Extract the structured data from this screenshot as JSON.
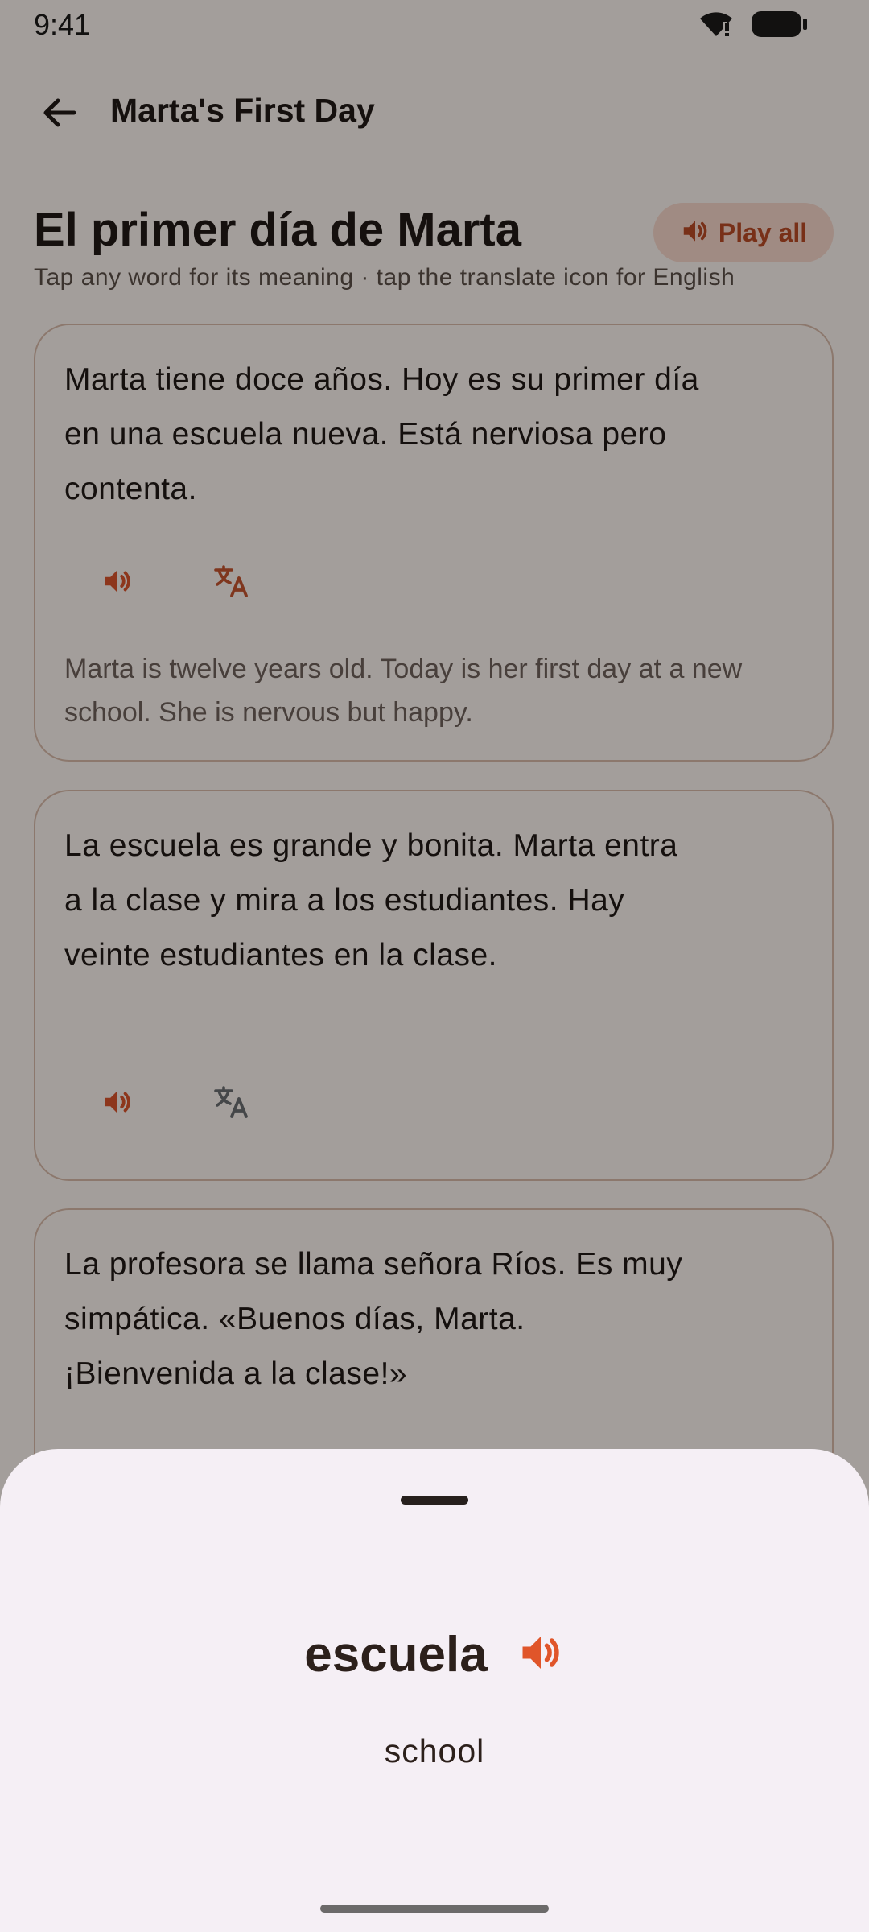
{
  "status": {
    "time": "9:41"
  },
  "header": {
    "title": "Marta's First Day"
  },
  "story": {
    "title": "El primer día de Marta",
    "play_all_label": "Play all",
    "subtitle": "Tap any word for its meaning · tap the translate icon for English"
  },
  "paragraphs": [
    {
      "text": "Marta tiene doce años. Hoy es su primer día en una escuela nueva. Está nerviosa pero contenta.",
      "translation": "Marta is twelve years old. Today is her first day at a new school. She is nervous but happy."
    },
    {
      "text": "La escuela es grande y bonita. Marta entra a la clase y mira a los estudiantes. Hay veinte estudiantes en la clase."
    },
    {
      "text": "La profesora se llama señora Ríos. Es muy simpática. «Buenos días, Marta. ¡Bienvenida a la clase!»"
    }
  ],
  "sheet": {
    "word": "escuela",
    "meaning": "school"
  },
  "colors": {
    "accent": "#d9542b",
    "translate_active": "#c3542e",
    "translate_inactive": "#6a6d70"
  }
}
